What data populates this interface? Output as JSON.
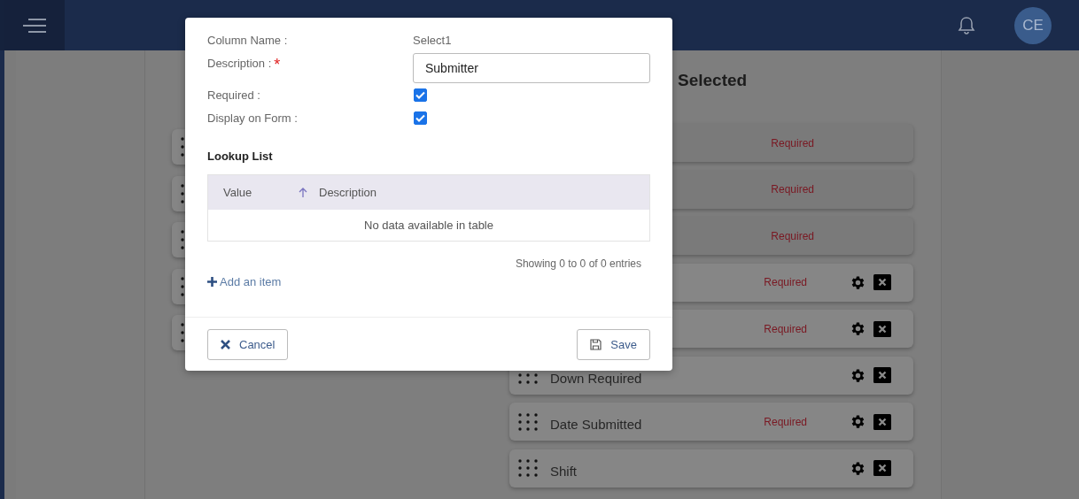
{
  "header": {
    "avatar": "CE"
  },
  "available_panel": {
    "cards": [
      {
        "kind": "drag"
      },
      {
        "kind": "drag"
      },
      {
        "kind": "drag"
      },
      {
        "kind": "drag"
      },
      {
        "kind": "drag"
      }
    ]
  },
  "selected_panel": {
    "title": "Selected",
    "cards": [
      {
        "locked": true,
        "tag": "Required"
      },
      {
        "locked": true,
        "tag": "Required"
      },
      {
        "locked": true,
        "tag": "Required"
      },
      {
        "locked": false,
        "tag": "Required"
      },
      {
        "locked": false,
        "tag": "Required"
      },
      {
        "locked": false,
        "label": "Down Required"
      },
      {
        "locked": false,
        "label": "Date Submitted",
        "tag": "Required"
      },
      {
        "locked": false,
        "label": "Shift"
      }
    ]
  },
  "dialog": {
    "fields": [
      {
        "kind": "text",
        "label": "Column Name :",
        "value": "Select1"
      },
      {
        "kind": "input",
        "label": "Description :",
        "required_mark": "*",
        "value": "Submitter"
      },
      {
        "kind": "checkbox",
        "label": "Required :",
        "checked": true
      },
      {
        "kind": "checkbox",
        "label": "Display on Form :",
        "checked": true
      }
    ],
    "lookup": {
      "title": "Lookup List",
      "columns": [
        {
          "label": "Value",
          "sorted": true
        },
        {
          "label": "Description"
        }
      ],
      "empty_text": "No data available in table",
      "info": "Showing 0 to 0 of 0 entries",
      "add_link": "Add an item"
    },
    "buttons": [
      {
        "kind": "cancel",
        "label": "Cancel"
      },
      {
        "kind": "save",
        "label": "Save"
      }
    ]
  }
}
